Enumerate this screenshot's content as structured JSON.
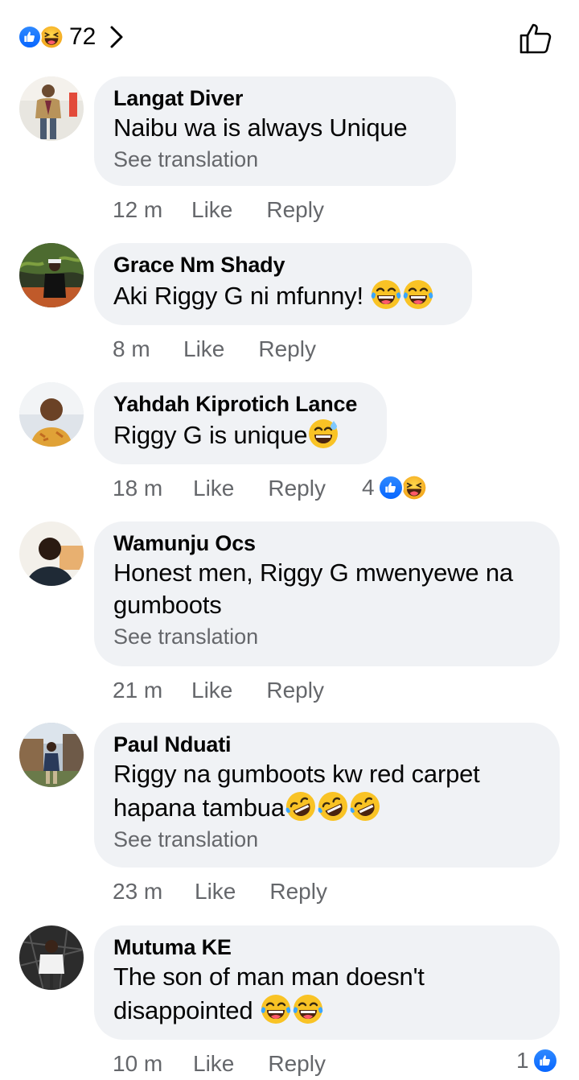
{
  "header": {
    "reaction_count": "72",
    "icons": [
      "like-reaction-icon",
      "haha-reaction-icon",
      "chevron-right-icon",
      "thumbs-up-outline-icon"
    ]
  },
  "comments": [
    {
      "name": "Langat Diver",
      "text": "Naibu wa is always Unique",
      "translation": "See translation",
      "time": "12 m",
      "like": "Like",
      "reply": "Reply"
    },
    {
      "name": "Grace Nm Shady",
      "text": "Aki Riggy G ni mfunny! ",
      "time": "8 m",
      "like": "Like",
      "reply": "Reply"
    },
    {
      "name": "Yahdah Kiprotich Lance",
      "text": "Riggy G is unique",
      "time": "18 m",
      "like": "Like",
      "reply": "Reply",
      "reactions": "4"
    },
    {
      "name": "Wamunju Ocs",
      "text_line1": "Honest men, Riggy G mwenyewe na",
      "text_line2": "gumboots",
      "translation": "See translation",
      "time": "21 m",
      "like": "Like",
      "reply": "Reply"
    },
    {
      "name": "Paul Nduati",
      "text_line1": "Riggy na gumboots kw red carpet",
      "text_line2": "hapana tambua",
      "translation": "See translation",
      "time": "23 m",
      "like": "Like",
      "reply": "Reply"
    },
    {
      "name": "Mutuma KE",
      "text_line1": "The son of man man doesn't",
      "text_line2": "disappointed ",
      "time": "10 m",
      "like": "Like",
      "reply": "Reply",
      "reactions": "1"
    }
  ],
  "colors": {
    "accent": "#0866ff",
    "bubble": "#f0f2f5",
    "meta": "#65676b"
  }
}
